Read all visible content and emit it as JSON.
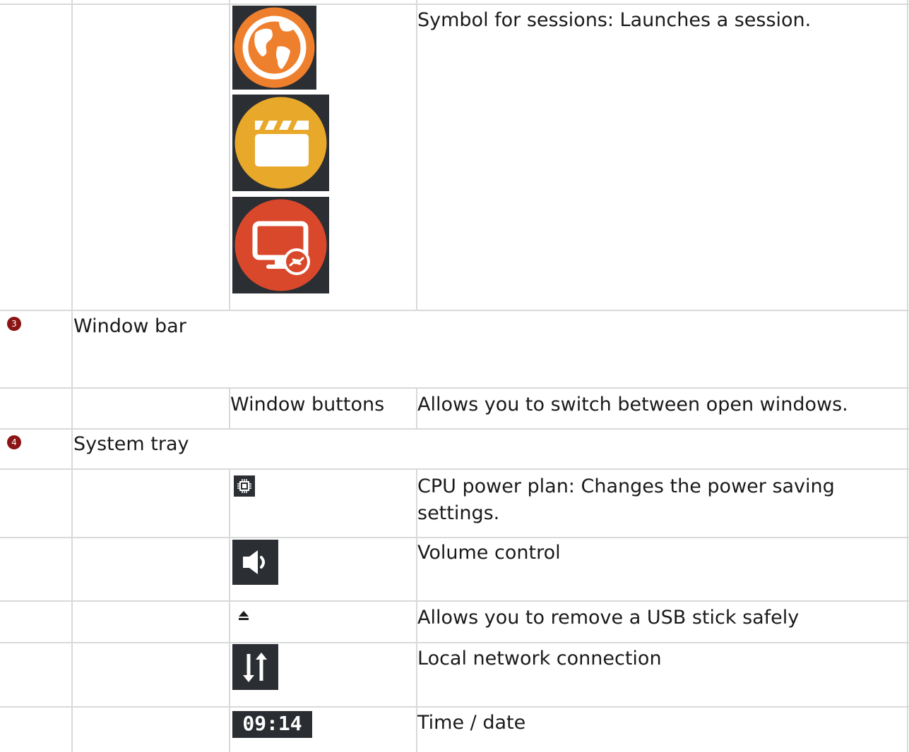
{
  "table": {
    "session_row": {
      "description": "Symbol for sessions: Launches a session.",
      "icons": [
        "globe-icon",
        "clapperboard-icon",
        "remote-desktop-icon"
      ]
    },
    "section3": {
      "badge": "3",
      "title": "Window bar"
    },
    "window_buttons_row": {
      "label": "Window buttons",
      "description": "Allows you to switch between open windows."
    },
    "section4": {
      "badge": "4",
      "title": "System tray"
    },
    "tray_rows": [
      {
        "icon": "cpu-icon",
        "description": "CPU power plan: Changes the power saving settings."
      },
      {
        "icon": "speaker-icon",
        "description": "Volume control"
      },
      {
        "icon": "eject-icon",
        "description": "Allows you to remove a USB stick safely"
      },
      {
        "icon": "network-arrows-icon",
        "description": "Local network connection"
      },
      {
        "icon": "clock-icon",
        "clock_text": "09:14",
        "description": "Time / date"
      }
    ]
  },
  "colors": {
    "globe": "#ee7f2d",
    "clapper": "#e8a82a",
    "remote": "#d9482b",
    "icon_bg": "#2b2e33",
    "badge": "#8b1414",
    "border": "#d9d9d9"
  }
}
